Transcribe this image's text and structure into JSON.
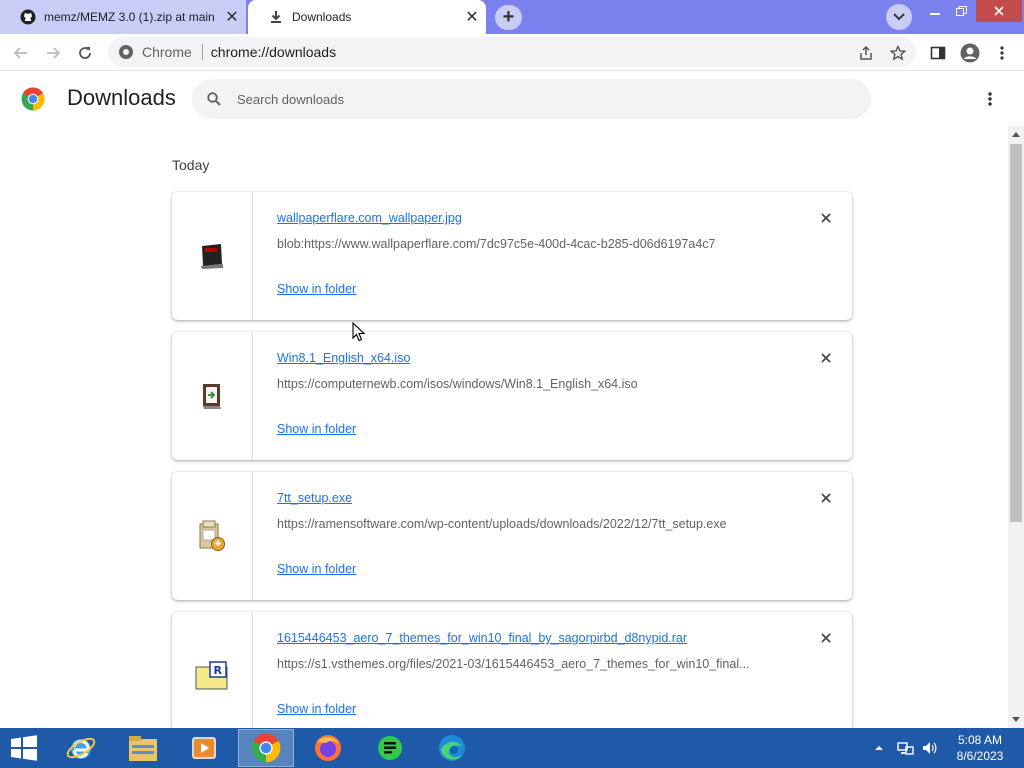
{
  "browser": {
    "tabs": [
      {
        "title": "memz/MEMZ 3.0 (1).zip at main",
        "active": false,
        "icon": "github-icon"
      },
      {
        "title": "Downloads",
        "active": true,
        "icon": "download-icon"
      }
    ],
    "omnibox": {
      "site_label": "Chrome",
      "url": "chrome://downloads"
    }
  },
  "page": {
    "title": "Downloads",
    "search_placeholder": "Search downloads",
    "date_group": "Today"
  },
  "downloads": [
    {
      "filename": "wallpaperflare.com_wallpaper.jpg",
      "url": "blob:https://www.wallpaperflare.com/7dc97c5e-400d-4cac-b285-d06d6197a4c7",
      "action": "Show in folder",
      "icon": "jpg-file-icon"
    },
    {
      "filename": "Win8.1_English_x64.iso",
      "url": "https://computernewb.com/isos/windows/Win8.1_English_x64.iso",
      "action": "Show in folder",
      "icon": "iso-file-icon"
    },
    {
      "filename": "7tt_setup.exe",
      "url": "https://ramensoftware.com/wp-content/uploads/downloads/2022/12/7tt_setup.exe",
      "action": "Show in folder",
      "icon": "installer-file-icon"
    },
    {
      "filename": "1615446453_aero_7_themes_for_win10_final_by_sagorpirbd_d8nypid.rar",
      "url": "https://s1.vsthemes.org/files/2021-03/1615446453_aero_7_themes_for_win10_final...",
      "action": "Show in folder",
      "icon": "rar-file-icon"
    }
  ],
  "taskbar": {
    "time": "5:08 AM",
    "date": "8/6/2023",
    "apps": [
      "internet-explorer-icon",
      "file-explorer-icon",
      "media-player-icon",
      "chrome-icon",
      "firefox-icon",
      "sheets-icon",
      "edge-icon"
    ]
  },
  "colors": {
    "tabstrip": "#7a80ee",
    "link": "#1a73e8",
    "taskbar": "#1f5aa8"
  }
}
